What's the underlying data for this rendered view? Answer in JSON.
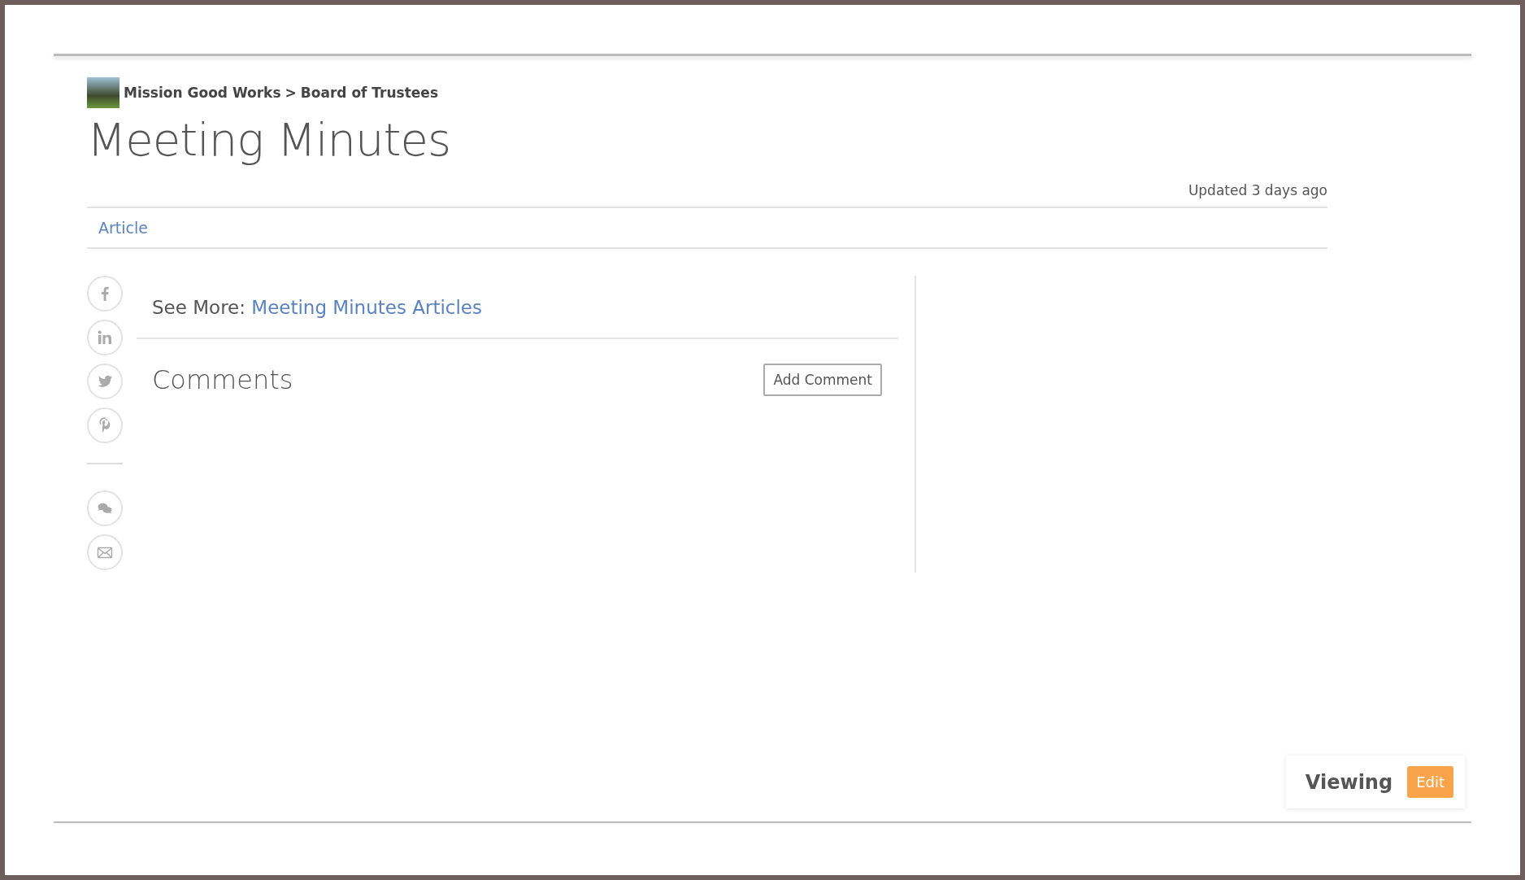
{
  "breadcrumb": {
    "group": "Mission Good Works",
    "separator": ">",
    "page": "Board of Trustees"
  },
  "title": "Meeting Minutes",
  "updated": "Updated 3 days ago",
  "tabs": [
    {
      "label": "Article",
      "selected": true
    }
  ],
  "share_icons": [
    {
      "kind": "facebook"
    },
    {
      "kind": "linkedin"
    },
    {
      "kind": "twitter"
    },
    {
      "kind": "pinterest"
    },
    {
      "kind": "divider"
    },
    {
      "kind": "chat"
    },
    {
      "kind": "email"
    }
  ],
  "see_more": {
    "label": "See More:",
    "link": "Meeting Minutes Articles"
  },
  "comments": {
    "heading": "Comments",
    "button": "Add Comment"
  },
  "mode_panel": {
    "label": "Viewing",
    "button": "Edit"
  }
}
